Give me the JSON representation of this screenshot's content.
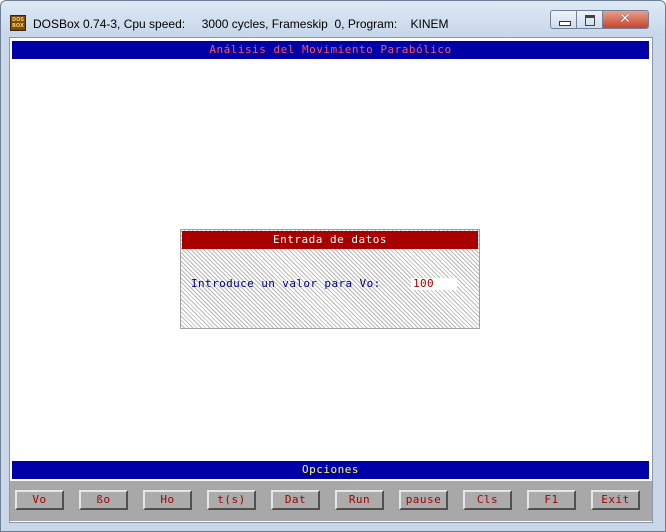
{
  "window": {
    "title": "DOSBox 0.74-3, Cpu speed:     3000 cycles, Frameskip  0, Program:    KINEM",
    "icon_text": "DOS BOX",
    "close_glyph": "✕"
  },
  "header": {
    "title": "Análisis del Movimiento Parabólico"
  },
  "dialog": {
    "title": "Entrada de datos",
    "prompt": "Introduce un valor para Vo:",
    "input_value": "100"
  },
  "options": {
    "title": "Opciones"
  },
  "buttons": [
    "Vo",
    "ßo",
    "Ho",
    "t(s)",
    "Dat",
    "Run",
    "pause",
    "Cls",
    "F1",
    "Exit"
  ],
  "colors": {
    "dos_blue": "#0000a8",
    "dos_red": "#a80000",
    "header_text": "#ff5555",
    "options_text": "#ffff55",
    "prompt_text": "#000088",
    "button_face": "#ababab"
  }
}
